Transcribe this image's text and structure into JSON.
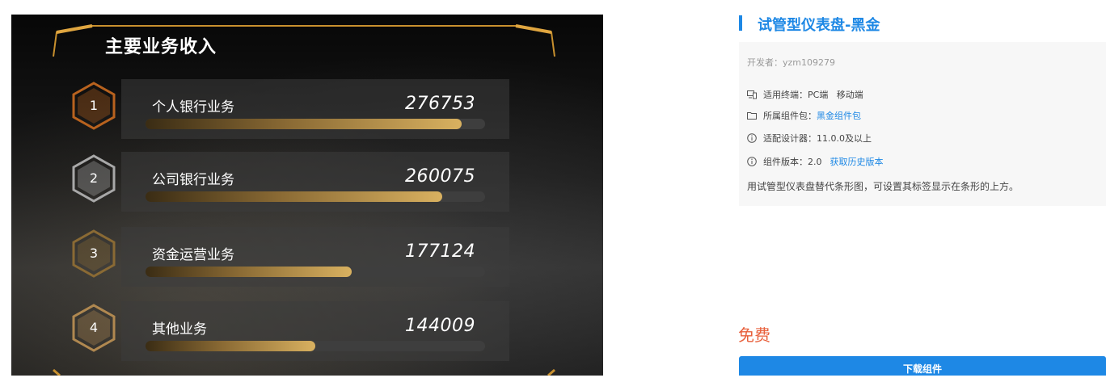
{
  "preview": {
    "title": "主要业务收入",
    "rows": [
      {
        "rank": "1",
        "label": "个人银行业务",
        "value": "276753",
        "fraction": 0.93,
        "hex_color": "#b8621e"
      },
      {
        "rank": "2",
        "label": "公司银行业务",
        "value": "260075",
        "fraction": 0.874,
        "hex_color": "#a8a8a8"
      },
      {
        "rank": "3",
        "label": "资金运营业务",
        "value": "177124",
        "fraction": 0.607,
        "hex_color": "#8a6a34"
      },
      {
        "rank": "4",
        "label": "其他业务",
        "value": "144009",
        "fraction": 0.5,
        "hex_color": "#b08850"
      }
    ]
  },
  "detail": {
    "title": "试管型仪表盘-黑金",
    "developer": "开发者：yzm109279",
    "terminal_label": "适用终端：",
    "terminal_value": "PC端   移动端",
    "package_label": "所属组件包：",
    "package_link": "黑金组件包",
    "designer": "适配设计器：11.0.0及以上",
    "version_label": "组件版本：2.0",
    "history_link": "获取历史版本",
    "description": "用试管型仪表盘替代条形图，可设置其标签显示在条形的上方。",
    "price": "免费",
    "download_label": "下载组件"
  },
  "colors": {
    "accent": "#1e88e5",
    "price": "#e8603c",
    "gold": "#d9b160"
  }
}
